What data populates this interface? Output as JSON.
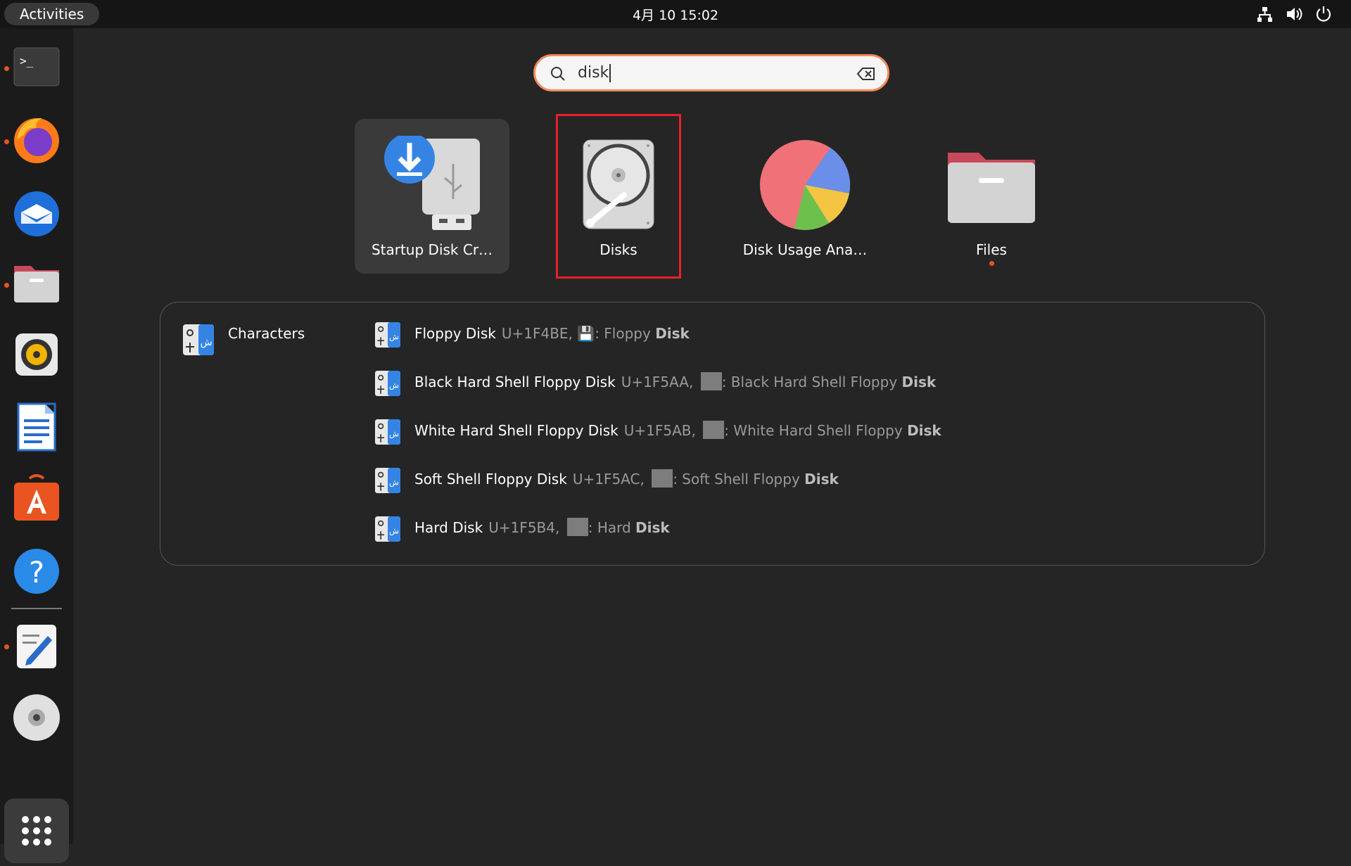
{
  "topbar": {
    "activities_label": "Activities",
    "clock": "4月 10  15:02",
    "tray_icons": [
      "network-icon",
      "volume-icon",
      "power-icon"
    ]
  },
  "dock": {
    "items": [
      {
        "name": "terminal",
        "running": true
      },
      {
        "name": "firefox",
        "running": true
      },
      {
        "name": "thunderbird",
        "running": false
      },
      {
        "name": "files",
        "running": true
      },
      {
        "name": "rhythmbox",
        "running": false
      },
      {
        "name": "libreoffice-writer",
        "running": false
      },
      {
        "name": "app-center",
        "running": false
      },
      {
        "name": "help",
        "running": false
      },
      {
        "name": "text-editor",
        "running": true
      },
      {
        "name": "disc",
        "running": false
      }
    ],
    "show_apps_icon": "app-grid-icon"
  },
  "search": {
    "value": "disk",
    "icon": "search-icon",
    "clear_icon": "backspace-clear-icon"
  },
  "apps": [
    {
      "label": "Startup Disk Cr…",
      "icon": "startup-disk-creator-icon",
      "selected": true
    },
    {
      "label": "Disks",
      "icon": "disks-icon",
      "highlighted": true
    },
    {
      "label": "Disk Usage Ana…",
      "icon": "disk-usage-analyzer-icon"
    },
    {
      "label": "Files",
      "icon": "files-icon",
      "running": true
    }
  ],
  "characters": {
    "provider_name": "Characters",
    "results": [
      {
        "name": "Floppy Disk",
        "code": "U+1F4BE,",
        "glyph": "💾",
        "desc": "Floppy",
        "match": "Disk"
      },
      {
        "name": "Black Hard Shell Floppy Disk",
        "code": "U+1F5AA,",
        "glyph": "",
        "desc": "Black Hard Shell Floppy",
        "match": "Disk"
      },
      {
        "name": "White Hard Shell Floppy Disk",
        "code": "U+1F5AB,",
        "glyph": "",
        "desc": "White Hard Shell Floppy",
        "match": "Disk"
      },
      {
        "name": "Soft Shell Floppy Disk",
        "code": "U+1F5AC,",
        "glyph": "",
        "desc": "Soft Shell Floppy",
        "match": "Disk"
      },
      {
        "name": "Hard Disk",
        "code": "U+1F5B4,",
        "glyph": "",
        "desc": "Hard",
        "match": "Disk"
      }
    ]
  },
  "colors": {
    "accent": "#e95420",
    "highlight_box": "#e8202a",
    "background": "#252525"
  }
}
